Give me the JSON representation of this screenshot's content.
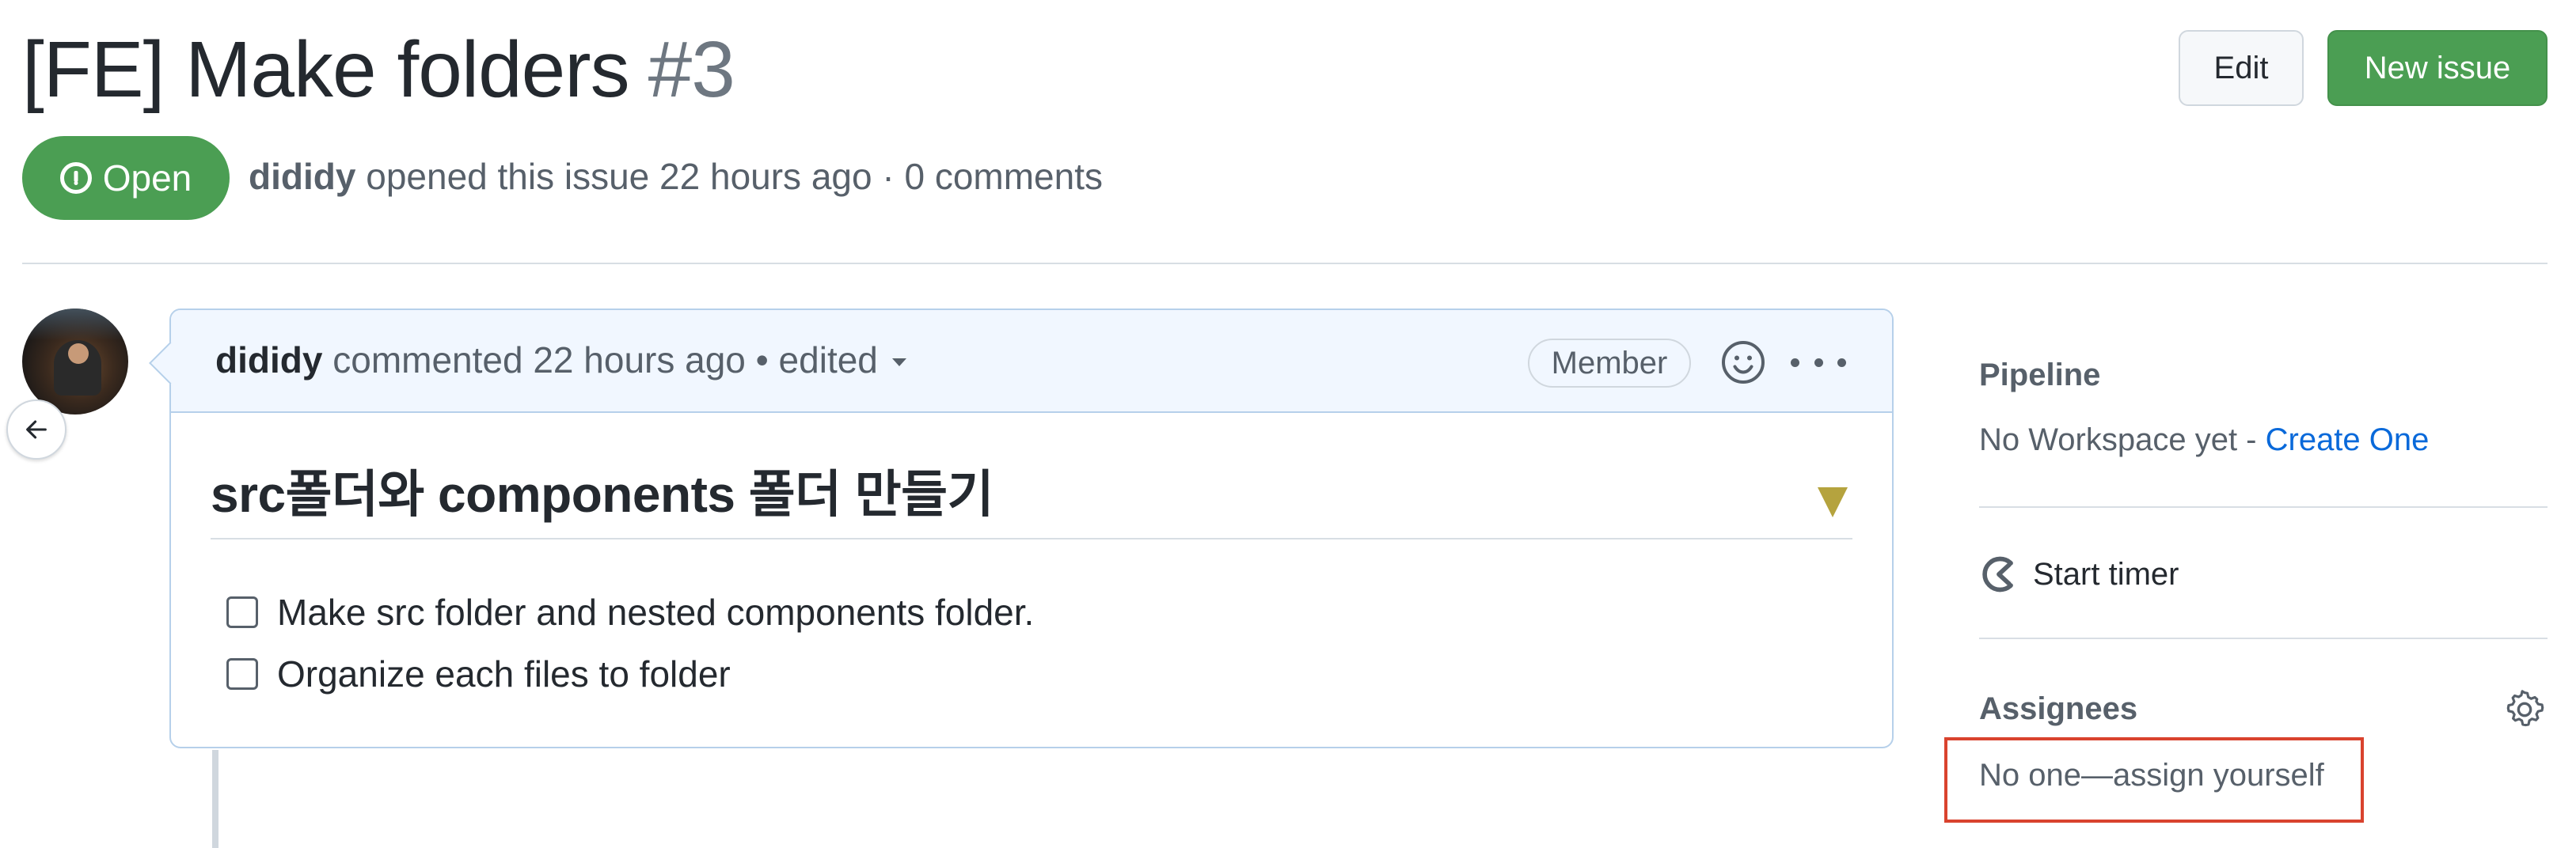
{
  "issue": {
    "title": "[FE] Make folders",
    "number": "#3",
    "state_label": "Open",
    "author": "dididy",
    "meta_text": " opened this issue 22 hours ago · 0 comments"
  },
  "header_actions": {
    "edit_label": "Edit",
    "new_issue_label": "New issue"
  },
  "comment": {
    "author": "dididy",
    "header_text": " commented 22 hours ago • edited",
    "role_badge": "Member",
    "heading": "src폴더와 components 폴더 만들기",
    "tasks": [
      {
        "label": "Make src folder and nested components folder.",
        "checked": false
      },
      {
        "label": "Organize each files to folder",
        "checked": false
      }
    ]
  },
  "sidebar": {
    "pipeline_heading": "Pipeline",
    "pipeline_text": "No Workspace yet - ",
    "pipeline_link": "Create One",
    "timer_label": "Start timer",
    "assignees_heading": "Assignees",
    "assignees_text": "No one—assign yourself"
  },
  "colors": {
    "open_green": "#4b9e53",
    "link_blue": "#0969da",
    "highlight_red": "#d9432e",
    "comment_header_bg": "#f1f7ff"
  },
  "icons": [
    "issue-opened-icon",
    "arrow-left-icon",
    "smiley-icon",
    "kebab-horizontal-icon",
    "triangle-down-icon",
    "timer-icon",
    "gear-icon"
  ]
}
